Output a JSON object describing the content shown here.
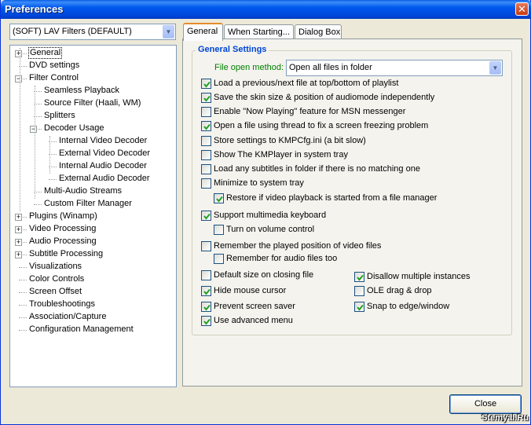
{
  "window": {
    "title": "Preferences",
    "close_glyph": "✕"
  },
  "filter_combo": {
    "value": "(SOFT) LAV Filters (DEFAULT)"
  },
  "tree": {
    "items": [
      {
        "label": "General",
        "selected": true,
        "expander": "+"
      },
      {
        "label": "DVD settings"
      },
      {
        "label": "Filter Control",
        "expander": "−"
      },
      {
        "label": "Seamless Playback"
      },
      {
        "label": "Source Filter (Haali, WM)"
      },
      {
        "label": "Splitters"
      },
      {
        "label": "Decoder Usage",
        "expander": "−"
      },
      {
        "label": "Internal Video Decoder"
      },
      {
        "label": "External Video Decoder"
      },
      {
        "label": "Internal Audio Decoder"
      },
      {
        "label": "External Audio Decoder"
      },
      {
        "label": "Multi-Audio Streams"
      },
      {
        "label": "Custom Filter Manager"
      },
      {
        "label": "Plugins (Winamp)",
        "expander": "+"
      },
      {
        "label": "Video Processing",
        "expander": "+"
      },
      {
        "label": "Audio Processing",
        "expander": "+"
      },
      {
        "label": "Subtitle Processing",
        "expander": "+"
      },
      {
        "label": "Visualizations"
      },
      {
        "label": "Color Controls"
      },
      {
        "label": "Screen Offset"
      },
      {
        "label": "Troubleshootings"
      },
      {
        "label": "Association/Capture"
      },
      {
        "label": "Configuration Management"
      }
    ]
  },
  "tabs": [
    {
      "label": "General",
      "active": true
    },
    {
      "label": "When Starting..."
    },
    {
      "label": "Dialog Box"
    }
  ],
  "general_settings": {
    "group_title": "General Settings",
    "file_open_method_label": "File open method:",
    "file_open_method_value": "Open all files in folder",
    "options": [
      {
        "label": "Load a previous/next file at top/bottom of playlist",
        "checked": true
      },
      {
        "label": "Save the skin size & position of audiomode independently",
        "checked": true
      },
      {
        "label": "Enable \"Now Playing\" feature for MSN messenger",
        "checked": false
      },
      {
        "label": "Open a file using thread to fix a screen freezing problem",
        "checked": true
      },
      {
        "label": "Store settings to KMPCfg.ini (a bit slow)",
        "checked": false
      },
      {
        "label": "Show The KMPlayer in system tray",
        "checked": false
      },
      {
        "label": "Load any subtitles in folder if there is no matching one",
        "checked": false
      },
      {
        "label": "Minimize to system tray",
        "checked": false
      },
      {
        "label": "Restore if video playback is started from a file manager",
        "checked": true
      },
      {
        "label": "Support multimedia keyboard",
        "checked": true
      },
      {
        "label": "Turn on volume control",
        "checked": false
      },
      {
        "label": "Remember the played position of video files",
        "checked": false
      },
      {
        "label": "Remember for audio files too",
        "checked": false
      },
      {
        "label": "Default size on closing file",
        "checked": false
      },
      {
        "label": "Disallow multiple instances",
        "checked": true
      },
      {
        "label": "Hide mouse cursor",
        "checked": true
      },
      {
        "label": "OLE drag & drop",
        "checked": false
      },
      {
        "label": "Prevent screen saver",
        "checked": true
      },
      {
        "label": "Snap to edge/window",
        "checked": true
      },
      {
        "label": "Use advanced menu",
        "checked": true
      }
    ]
  },
  "footer": {
    "close_label": "Close",
    "watermark": "Stemyal.Ru"
  },
  "colors": {
    "title_blue": "#0058ee",
    "group_title": "#0046d5",
    "green_label": "#008000",
    "tab_accent": "#e68b2c"
  }
}
